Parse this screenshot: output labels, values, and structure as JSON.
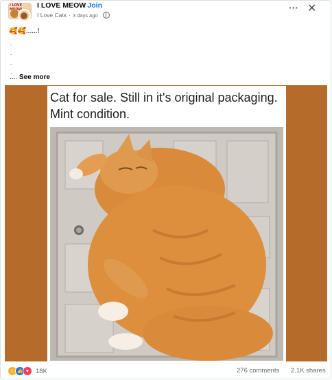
{
  "post": {
    "group_name": "I LOVE MEOW",
    "join_label": "· Join",
    "author": "I Love Cats",
    "time": "3 days ago",
    "more_icon": "···",
    "close_icon": "✕",
    "emojis": "🥰🥰",
    "caption_text": "......!",
    "dots": [
      ".",
      ".",
      ".",
      "."
    ],
    "ellipsis": "....",
    "see_more_label": "See more",
    "image_caption": "Cat for sale. Still in it's original packaging. Mint condition.",
    "avatar_text": "I LOVE MEOW"
  },
  "footer": {
    "reaction_icons": [
      "haha-icon",
      "like-icon",
      "love-icon"
    ],
    "reactions_count": "18K",
    "comments": "276 comments",
    "shares": "2.1K shares"
  },
  "colors": {
    "accent": "#1b74e4",
    "photo_background": "#b56b2a",
    "muted_text": "#65676b"
  }
}
